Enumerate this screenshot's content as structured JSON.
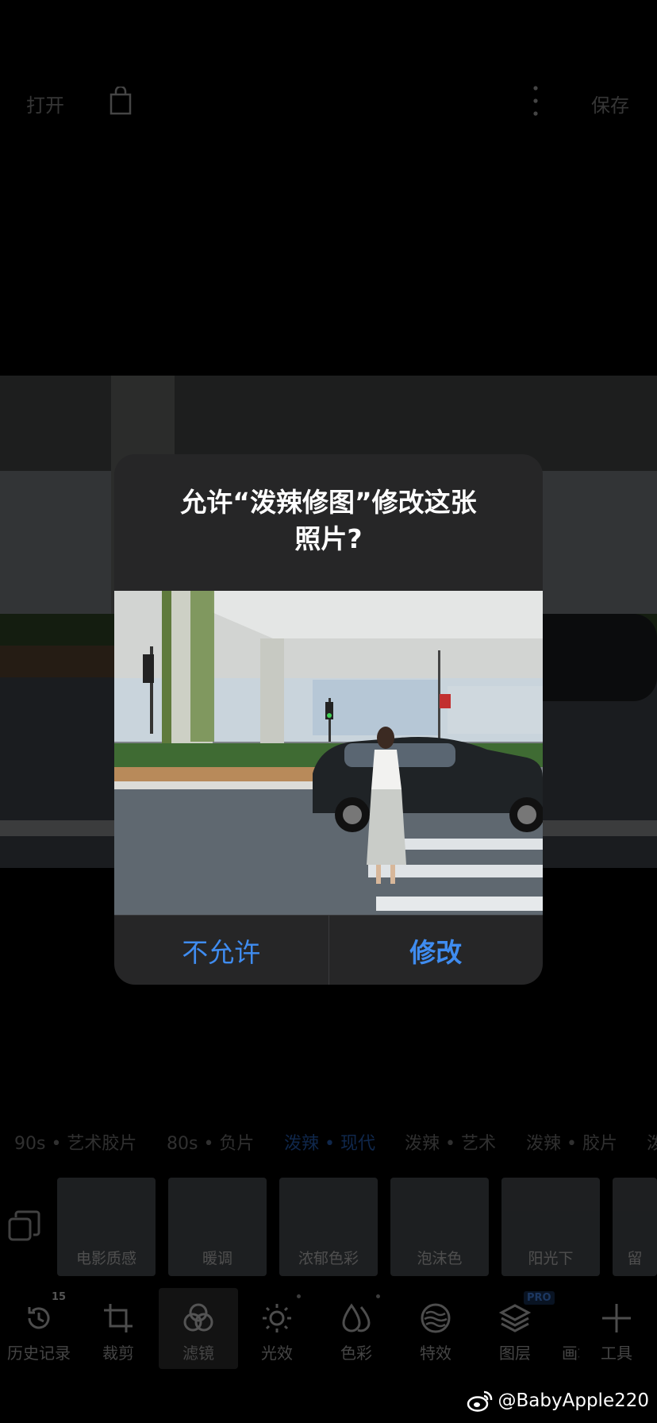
{
  "topbar": {
    "open_label": "打开",
    "save_label": "保存",
    "bag_icon": "shopping-bag-icon",
    "more_icon": "more-vertical-icon"
  },
  "alert": {
    "title_line1": "允许“泼辣修图”修改这张",
    "title_line2": "照片?",
    "deny_label": "不允许",
    "allow_label": "修改",
    "button_color": "#3f8cf0"
  },
  "filter_categories": [
    {
      "label": "90s • 艺术胶片",
      "active": false
    },
    {
      "label": "80s • 负片",
      "active": false
    },
    {
      "label": "泼辣 • 现代",
      "active": true
    },
    {
      "label": "泼辣 • 艺术",
      "active": false
    },
    {
      "label": "泼辣 • 胶片",
      "active": false
    },
    {
      "label": "泼",
      "active": false
    }
  ],
  "filters": [
    {
      "label": "电影质感"
    },
    {
      "label": "暖调"
    },
    {
      "label": "浓郁色彩"
    },
    {
      "label": "泡沫色"
    },
    {
      "label": "阳光下"
    },
    {
      "label": "留"
    }
  ],
  "tools": [
    {
      "label": "历史记录",
      "icon": "history-icon",
      "badge": "15"
    },
    {
      "label": "裁剪",
      "icon": "crop-icon"
    },
    {
      "label": "滤镜",
      "icon": "filters-icon",
      "active": true
    },
    {
      "label": "光效",
      "icon": "light-icon"
    },
    {
      "label": "色彩",
      "icon": "color-icon"
    },
    {
      "label": "特效",
      "icon": "effects-icon"
    },
    {
      "label": "图层",
      "icon": "layers-icon",
      "badge": "PRO"
    },
    {
      "label": "画笔",
      "icon": "brush-icon"
    },
    {
      "label": "工具",
      "icon": "tools-icon"
    }
  ],
  "watermark": {
    "text": "@BabyApple220",
    "icon": "weibo-icon"
  }
}
